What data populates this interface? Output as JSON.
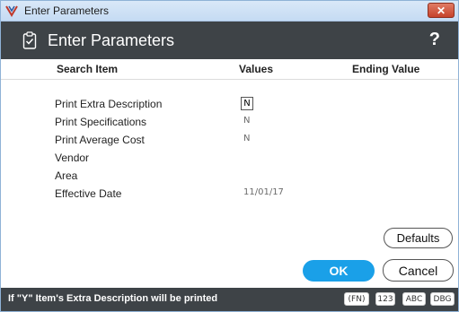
{
  "window": {
    "title": "Enter Parameters",
    "close_glyph": "✕"
  },
  "header": {
    "title": "Enter Parameters",
    "help": "?"
  },
  "columns": {
    "search_item": "Search Item",
    "values": "Values",
    "ending_value": "Ending Value"
  },
  "rows": [
    {
      "label": "Print Extra Description",
      "value": "N"
    },
    {
      "label": "Print Specifications",
      "value": "N"
    },
    {
      "label": "Print Average Cost",
      "value": "N"
    },
    {
      "label": "Vendor",
      "value": ""
    },
    {
      "label": "Area",
      "value": ""
    },
    {
      "label": "Effective Date",
      "value": "11/01/17"
    }
  ],
  "buttons": {
    "defaults": "Defaults",
    "ok": "OK",
    "cancel": "Cancel"
  },
  "status": {
    "message": "If \"Y\" Item's Extra Description will be printed",
    "keys": [
      "(FN)",
      "123",
      "ABC",
      "DBG"
    ]
  },
  "colors": {
    "header_bg": "#3e4347",
    "ok_bg": "#1aa0e8",
    "close_bg": "#c6432b"
  },
  "icons": {
    "app": "app-logo-icon",
    "clipboard": "clipboard-icon"
  }
}
